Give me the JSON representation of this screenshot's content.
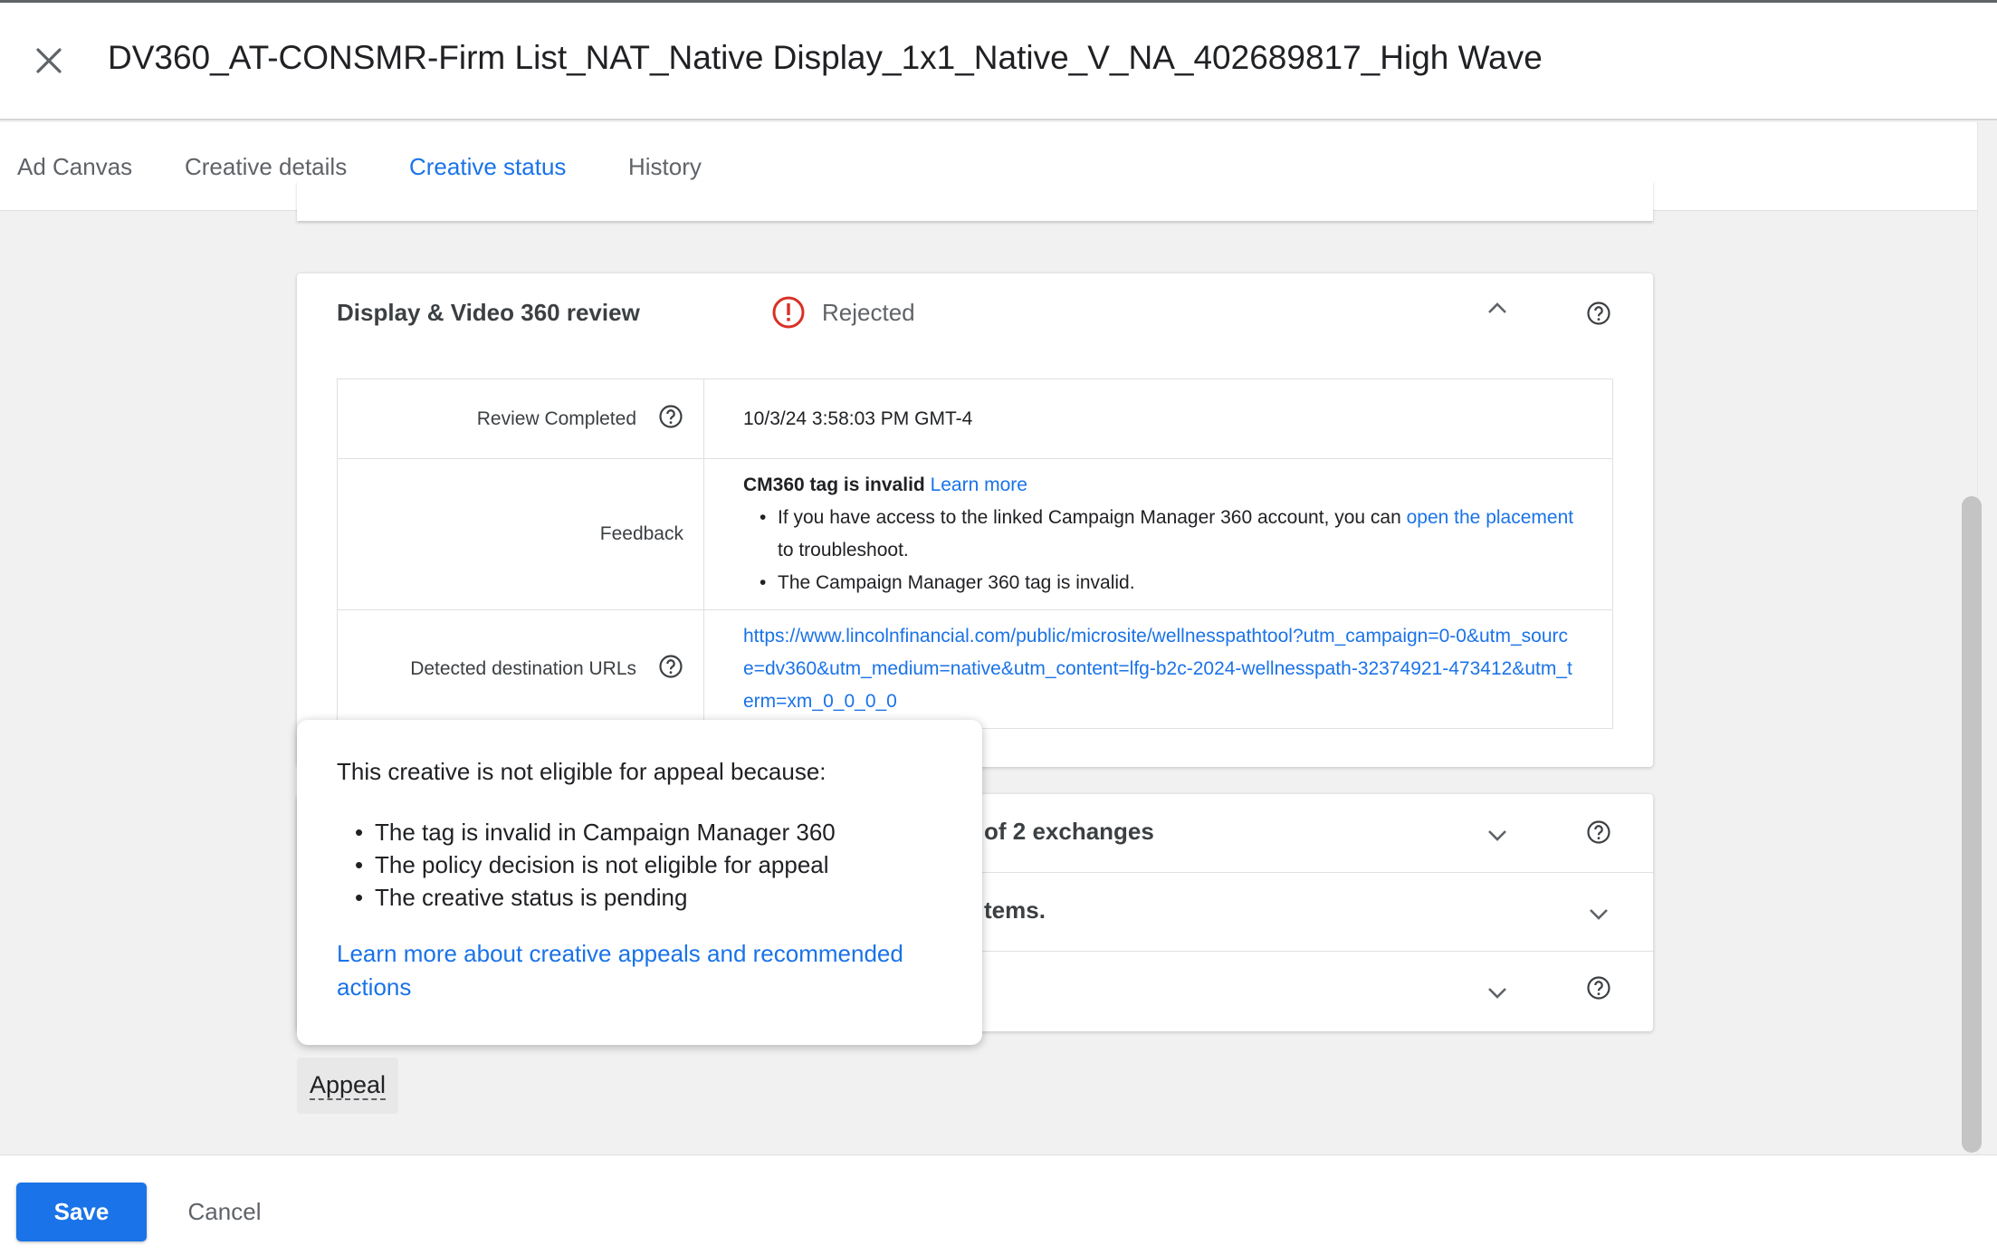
{
  "header": {
    "title": "DV360_AT-CONSMR-Firm List_NAT_Native Display_1x1_Native_V_NA_402689817_High Wave"
  },
  "tabs": [
    {
      "label": "Ad Canvas"
    },
    {
      "label": "Creative details"
    },
    {
      "label": "Creative status"
    },
    {
      "label": "History"
    }
  ],
  "active_tab": "Creative status",
  "review": {
    "title": "Display & Video 360 review",
    "status": "Rejected",
    "status_color": "#d93025",
    "rows": {
      "review_completed": {
        "label": "Review Completed",
        "value": "10/3/24 3:58:03 PM GMT-4"
      },
      "feedback": {
        "label": "Feedback",
        "heading": "CM360 tag is invalid",
        "learn_more": "Learn more",
        "bullet1_prefix": "If you have access to the linked Campaign Manager 360 account, you can",
        "bullet1_link": "open the placement",
        "bullet1_suffix": "to troubleshoot.",
        "bullet2": "The Campaign Manager 360 tag is invalid."
      },
      "urls": {
        "label": "Detected destination URLs",
        "value": "https://www.lincolnfinancial.com/public/microsite/wellnesspathtool?utm_campaign=0-0&utm_source=dv360&utm_medium=native&utm_content=lfg-b2c-2024-wellnesspath-32374921-473412&utm_term=xm_0_0_0_0"
      }
    }
  },
  "lower_rows": [
    {
      "text": "of 2 exchanges"
    },
    {
      "text": "tems."
    },
    {
      "text": ""
    }
  ],
  "popover": {
    "heading": "This creative is not eligible for appeal because:",
    "reasons": [
      "The tag is invalid in Campaign Manager 360",
      "The policy decision is not eligible for appeal",
      "The creative status is pending"
    ],
    "link": "Learn more about creative appeals and recommended actions"
  },
  "appeal_label": "Appeal",
  "footer": {
    "save_label": "Save",
    "cancel_label": "Cancel"
  },
  "colors": {
    "accent": "#1a73e8",
    "error": "#d93025"
  }
}
